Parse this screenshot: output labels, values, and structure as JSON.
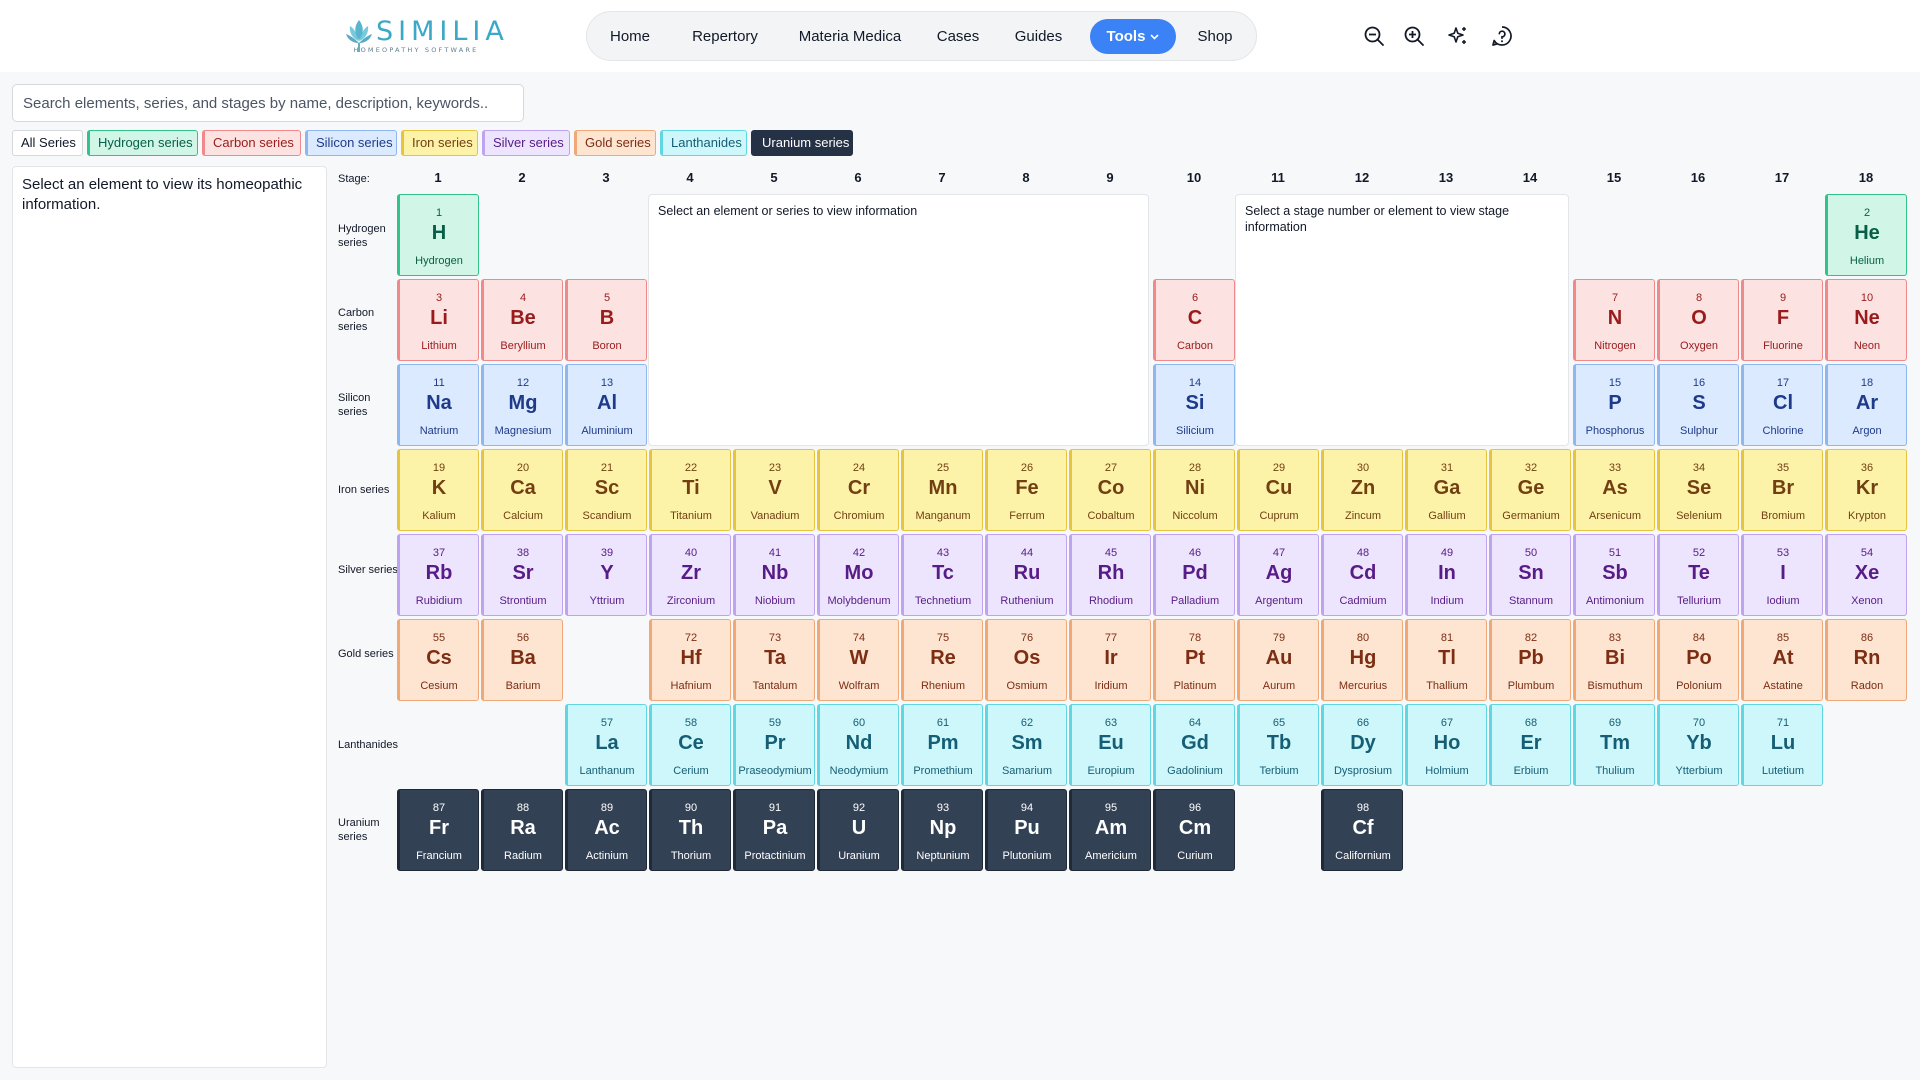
{
  "header": {
    "logo": {
      "name": "SIMILIA",
      "tagline": "HOMEOPATHY SOFTWARE",
      "icon": "lotus-icon"
    },
    "nav": [
      {
        "label": "Home"
      },
      {
        "label": "Repertory"
      },
      {
        "label": "Materia Medica"
      },
      {
        "label": "Cases"
      },
      {
        "label": "Guides"
      },
      {
        "label": "Tools",
        "active": true,
        "dropdown": true
      },
      {
        "label": "Shop"
      }
    ],
    "tools": [
      "zoom-out-icon",
      "zoom-in-icon",
      "sparkle-icon",
      "help-icon"
    ],
    "accent": "#3b82f6"
  },
  "search": {
    "placeholder": "Search elements, series, and stages by name, description, keywords..",
    "value": ""
  },
  "filters": [
    {
      "label": "All Series",
      "series": "all"
    },
    {
      "label": "Hydrogen series",
      "series": "hydrogen"
    },
    {
      "label": "Carbon series",
      "series": "carbon"
    },
    {
      "label": "Silicon series",
      "series": "silicon"
    },
    {
      "label": "Iron series",
      "series": "iron"
    },
    {
      "label": "Silver series",
      "series": "silver"
    },
    {
      "label": "Gold series",
      "series": "gold"
    },
    {
      "label": "Lanthanides",
      "series": "lanthanides"
    },
    {
      "label": "Uranium series",
      "series": "uranium",
      "active": true
    }
  ],
  "info_panel": {
    "text": "Select an element to view its homeopathic information."
  },
  "series_info": {
    "text": "Select an element or series to view information"
  },
  "stage_info": {
    "text": "Select a stage number or element to view stage information"
  },
  "grid": {
    "stage_label": "Stage:",
    "stages": [
      "1",
      "2",
      "3",
      "4",
      "5",
      "6",
      "7",
      "8",
      "9",
      "10",
      "11",
      "12",
      "13",
      "14",
      "15",
      "16",
      "17",
      "18"
    ],
    "rows": [
      {
        "key": "hydrogen",
        "label": "Hydrogen series"
      },
      {
        "key": "carbon",
        "label": "Carbon series"
      },
      {
        "key": "silicon",
        "label": "Silicon series"
      },
      {
        "key": "iron",
        "label": "Iron series"
      },
      {
        "key": "silver",
        "label": "Silver series"
      },
      {
        "key": "gold",
        "label": "Gold series"
      },
      {
        "key": "lanthanides",
        "label": "Lanthanides"
      },
      {
        "key": "uranium",
        "label": "Uranium series"
      }
    ]
  },
  "colors": {
    "hydrogen": {
      "bg": "#d1f5e6",
      "border": "#34c28b",
      "text": "#065f46"
    },
    "carbon": {
      "bg": "#fde2e2",
      "border": "#f08a8a",
      "text": "#991b1b"
    },
    "silicon": {
      "bg": "#dbeafe",
      "border": "#8fb6ee",
      "text": "#1e3a8a"
    },
    "iron": {
      "bg": "#fdf3a8",
      "border": "#e6c440",
      "text": "#713f12"
    },
    "silver": {
      "bg": "#ede4fd",
      "border": "#bda3f0",
      "text": "#581c87"
    },
    "gold": {
      "bg": "#fde5d2",
      "border": "#f0a877",
      "text": "#7c2d12"
    },
    "lanthanides": {
      "bg": "#cdf7fa",
      "border": "#5fd6e2",
      "text": "#155e75"
    },
    "uranium": {
      "bg": "#334155",
      "border": "#1f2937",
      "text": "#ffffff"
    }
  },
  "elements": [
    {
      "num": "1",
      "sym": "H",
      "name": "Hydrogen",
      "series": "hydrogen",
      "stage": 1
    },
    {
      "num": "2",
      "sym": "He",
      "name": "Helium",
      "series": "hydrogen",
      "stage": 18
    },
    {
      "num": "3",
      "sym": "Li",
      "name": "Lithium",
      "series": "carbon",
      "stage": 1
    },
    {
      "num": "4",
      "sym": "Be",
      "name": "Beryllium",
      "series": "carbon",
      "stage": 2
    },
    {
      "num": "5",
      "sym": "B",
      "name": "Boron",
      "series": "carbon",
      "stage": 3
    },
    {
      "num": "6",
      "sym": "C",
      "name": "Carbon",
      "series": "carbon",
      "stage": 10
    },
    {
      "num": "7",
      "sym": "N",
      "name": "Nitrogen",
      "series": "carbon",
      "stage": 15
    },
    {
      "num": "8",
      "sym": "O",
      "name": "Oxygen",
      "series": "carbon",
      "stage": 16
    },
    {
      "num": "9",
      "sym": "F",
      "name": "Fluorine",
      "series": "carbon",
      "stage": 17
    },
    {
      "num": "10",
      "sym": "Ne",
      "name": "Neon",
      "series": "carbon",
      "stage": 18
    },
    {
      "num": "11",
      "sym": "Na",
      "name": "Natrium",
      "series": "silicon",
      "stage": 1
    },
    {
      "num": "12",
      "sym": "Mg",
      "name": "Magnesium",
      "series": "silicon",
      "stage": 2
    },
    {
      "num": "13",
      "sym": "Al",
      "name": "Aluminium",
      "series": "silicon",
      "stage": 3
    },
    {
      "num": "14",
      "sym": "Si",
      "name": "Silicium",
      "series": "silicon",
      "stage": 10
    },
    {
      "num": "15",
      "sym": "P",
      "name": "Phosphorus",
      "series": "silicon",
      "stage": 15
    },
    {
      "num": "16",
      "sym": "S",
      "name": "Sulphur",
      "series": "silicon",
      "stage": 16
    },
    {
      "num": "17",
      "sym": "Cl",
      "name": "Chlorine",
      "series": "silicon",
      "stage": 17
    },
    {
      "num": "18",
      "sym": "Ar",
      "name": "Argon",
      "series": "silicon",
      "stage": 18
    },
    {
      "num": "19",
      "sym": "K",
      "name": "Kalium",
      "series": "iron",
      "stage": 1
    },
    {
      "num": "20",
      "sym": "Ca",
      "name": "Calcium",
      "series": "iron",
      "stage": 2
    },
    {
      "num": "21",
      "sym": "Sc",
      "name": "Scandium",
      "series": "iron",
      "stage": 3
    },
    {
      "num": "22",
      "sym": "Ti",
      "name": "Titanium",
      "series": "iron",
      "stage": 4
    },
    {
      "num": "23",
      "sym": "V",
      "name": "Vanadium",
      "series": "iron",
      "stage": 5
    },
    {
      "num": "24",
      "sym": "Cr",
      "name": "Chromium",
      "series": "iron",
      "stage": 6
    },
    {
      "num": "25",
      "sym": "Mn",
      "name": "Manganum",
      "series": "iron",
      "stage": 7
    },
    {
      "num": "26",
      "sym": "Fe",
      "name": "Ferrum",
      "series": "iron",
      "stage": 8
    },
    {
      "num": "27",
      "sym": "Co",
      "name": "Cobaltum",
      "series": "iron",
      "stage": 9
    },
    {
      "num": "28",
      "sym": "Ni",
      "name": "Niccolum",
      "series": "iron",
      "stage": 10
    },
    {
      "num": "29",
      "sym": "Cu",
      "name": "Cuprum",
      "series": "iron",
      "stage": 11
    },
    {
      "num": "30",
      "sym": "Zn",
      "name": "Zincum",
      "series": "iron",
      "stage": 12
    },
    {
      "num": "31",
      "sym": "Ga",
      "name": "Gallium",
      "series": "iron",
      "stage": 13
    },
    {
      "num": "32",
      "sym": "Ge",
      "name": "Germanium",
      "series": "iron",
      "stage": 14
    },
    {
      "num": "33",
      "sym": "As",
      "name": "Arsenicum",
      "series": "iron",
      "stage": 15
    },
    {
      "num": "34",
      "sym": "Se",
      "name": "Selenium",
      "series": "iron",
      "stage": 16
    },
    {
      "num": "35",
      "sym": "Br",
      "name": "Bromium",
      "series": "iron",
      "stage": 17
    },
    {
      "num": "36",
      "sym": "Kr",
      "name": "Krypton",
      "series": "iron",
      "stage": 18
    },
    {
      "num": "37",
      "sym": "Rb",
      "name": "Rubidium",
      "series": "silver",
      "stage": 1
    },
    {
      "num": "38",
      "sym": "Sr",
      "name": "Strontium",
      "series": "silver",
      "stage": 2
    },
    {
      "num": "39",
      "sym": "Y",
      "name": "Yttrium",
      "series": "silver",
      "stage": 3
    },
    {
      "num": "40",
      "sym": "Zr",
      "name": "Zirconium",
      "series": "silver",
      "stage": 4
    },
    {
      "num": "41",
      "sym": "Nb",
      "name": "Niobium",
      "series": "silver",
      "stage": 5
    },
    {
      "num": "42",
      "sym": "Mo",
      "name": "Molybdenum",
      "series": "silver",
      "stage": 6
    },
    {
      "num": "43",
      "sym": "Tc",
      "name": "Technetium",
      "series": "silver",
      "stage": 7
    },
    {
      "num": "44",
      "sym": "Ru",
      "name": "Ruthenium",
      "series": "silver",
      "stage": 8
    },
    {
      "num": "45",
      "sym": "Rh",
      "name": "Rhodium",
      "series": "silver",
      "stage": 9
    },
    {
      "num": "46",
      "sym": "Pd",
      "name": "Palladium",
      "series": "silver",
      "stage": 10
    },
    {
      "num": "47",
      "sym": "Ag",
      "name": "Argentum",
      "series": "silver",
      "stage": 11
    },
    {
      "num": "48",
      "sym": "Cd",
      "name": "Cadmium",
      "series": "silver",
      "stage": 12
    },
    {
      "num": "49",
      "sym": "In",
      "name": "Indium",
      "series": "silver",
      "stage": 13
    },
    {
      "num": "50",
      "sym": "Sn",
      "name": "Stannum",
      "series": "silver",
      "stage": 14
    },
    {
      "num": "51",
      "sym": "Sb",
      "name": "Antimonium",
      "series": "silver",
      "stage": 15
    },
    {
      "num": "52",
      "sym": "Te",
      "name": "Tellurium",
      "series": "silver",
      "stage": 16
    },
    {
      "num": "53",
      "sym": "I",
      "name": "Iodium",
      "series": "silver",
      "stage": 17
    },
    {
      "num": "54",
      "sym": "Xe",
      "name": "Xenon",
      "series": "silver",
      "stage": 18
    },
    {
      "num": "55",
      "sym": "Cs",
      "name": "Cesium",
      "series": "gold",
      "stage": 1
    },
    {
      "num": "56",
      "sym": "Ba",
      "name": "Barium",
      "series": "gold",
      "stage": 2
    },
    {
      "num": "72",
      "sym": "Hf",
      "name": "Hafnium",
      "series": "gold",
      "stage": 4
    },
    {
      "num": "73",
      "sym": "Ta",
      "name": "Tantalum",
      "series": "gold",
      "stage": 5
    },
    {
      "num": "74",
      "sym": "W",
      "name": "Wolfram",
      "series": "gold",
      "stage": 6
    },
    {
      "num": "75",
      "sym": "Re",
      "name": "Rhenium",
      "series": "gold",
      "stage": 7
    },
    {
      "num": "76",
      "sym": "Os",
      "name": "Osmium",
      "series": "gold",
      "stage": 8
    },
    {
      "num": "77",
      "sym": "Ir",
      "name": "Iridium",
      "series": "gold",
      "stage": 9
    },
    {
      "num": "78",
      "sym": "Pt",
      "name": "Platinum",
      "series": "gold",
      "stage": 10
    },
    {
      "num": "79",
      "sym": "Au",
      "name": "Aurum",
      "series": "gold",
      "stage": 11
    },
    {
      "num": "80",
      "sym": "Hg",
      "name": "Mercurius",
      "series": "gold",
      "stage": 12
    },
    {
      "num": "81",
      "sym": "Tl",
      "name": "Thallium",
      "series": "gold",
      "stage": 13
    },
    {
      "num": "82",
      "sym": "Pb",
      "name": "Plumbum",
      "series": "gold",
      "stage": 14
    },
    {
      "num": "83",
      "sym": "Bi",
      "name": "Bismuthum",
      "series": "gold",
      "stage": 15
    },
    {
      "num": "84",
      "sym": "Po",
      "name": "Polonium",
      "series": "gold",
      "stage": 16
    },
    {
      "num": "85",
      "sym": "At",
      "name": "Astatine",
      "series": "gold",
      "stage": 17
    },
    {
      "num": "86",
      "sym": "Rn",
      "name": "Radon",
      "series": "gold",
      "stage": 18
    },
    {
      "num": "57",
      "sym": "La",
      "name": "Lanthanum",
      "series": "lanthanides",
      "stage": 3
    },
    {
      "num": "58",
      "sym": "Ce",
      "name": "Cerium",
      "series": "lanthanides",
      "stage": 4
    },
    {
      "num": "59",
      "sym": "Pr",
      "name": "Praseodymium",
      "series": "lanthanides",
      "stage": 5
    },
    {
      "num": "60",
      "sym": "Nd",
      "name": "Neodymium",
      "series": "lanthanides",
      "stage": 6
    },
    {
      "num": "61",
      "sym": "Pm",
      "name": "Promethium",
      "series": "lanthanides",
      "stage": 7
    },
    {
      "num": "62",
      "sym": "Sm",
      "name": "Samarium",
      "series": "lanthanides",
      "stage": 8
    },
    {
      "num": "63",
      "sym": "Eu",
      "name": "Europium",
      "series": "lanthanides",
      "stage": 9
    },
    {
      "num": "64",
      "sym": "Gd",
      "name": "Gadolinium",
      "series": "lanthanides",
      "stage": 10
    },
    {
      "num": "65",
      "sym": "Tb",
      "name": "Terbium",
      "series": "lanthanides",
      "stage": 11
    },
    {
      "num": "66",
      "sym": "Dy",
      "name": "Dysprosium",
      "series": "lanthanides",
      "stage": 12
    },
    {
      "num": "67",
      "sym": "Ho",
      "name": "Holmium",
      "series": "lanthanides",
      "stage": 13
    },
    {
      "num": "68",
      "sym": "Er",
      "name": "Erbium",
      "series": "lanthanides",
      "stage": 14
    },
    {
      "num": "69",
      "sym": "Tm",
      "name": "Thulium",
      "series": "lanthanides",
      "stage": 15
    },
    {
      "num": "70",
      "sym": "Yb",
      "name": "Ytterbium",
      "series": "lanthanides",
      "stage": 16
    },
    {
      "num": "71",
      "sym": "Lu",
      "name": "Lutetium",
      "series": "lanthanides",
      "stage": 17
    },
    {
      "num": "87",
      "sym": "Fr",
      "name": "Francium",
      "series": "uranium",
      "stage": 1
    },
    {
      "num": "88",
      "sym": "Ra",
      "name": "Radium",
      "series": "uranium",
      "stage": 2
    },
    {
      "num": "89",
      "sym": "Ac",
      "name": "Actinium",
      "series": "uranium",
      "stage": 3
    },
    {
      "num": "90",
      "sym": "Th",
      "name": "Thorium",
      "series": "uranium",
      "stage": 4
    },
    {
      "num": "91",
      "sym": "Pa",
      "name": "Protactinium",
      "series": "uranium",
      "stage": 5
    },
    {
      "num": "92",
      "sym": "U",
      "name": "Uranium",
      "series": "uranium",
      "stage": 6
    },
    {
      "num": "93",
      "sym": "Np",
      "name": "Neptunium",
      "series": "uranium",
      "stage": 7
    },
    {
      "num": "94",
      "sym": "Pu",
      "name": "Plutonium",
      "series": "uranium",
      "stage": 8
    },
    {
      "num": "95",
      "sym": "Am",
      "name": "Americium",
      "series": "uranium",
      "stage": 9
    },
    {
      "num": "96",
      "sym": "Cm",
      "name": "Curium",
      "series": "uranium",
      "stage": 10
    },
    {
      "num": "98",
      "sym": "Cf",
      "name": "Californium",
      "series": "uranium",
      "stage": 12
    }
  ]
}
